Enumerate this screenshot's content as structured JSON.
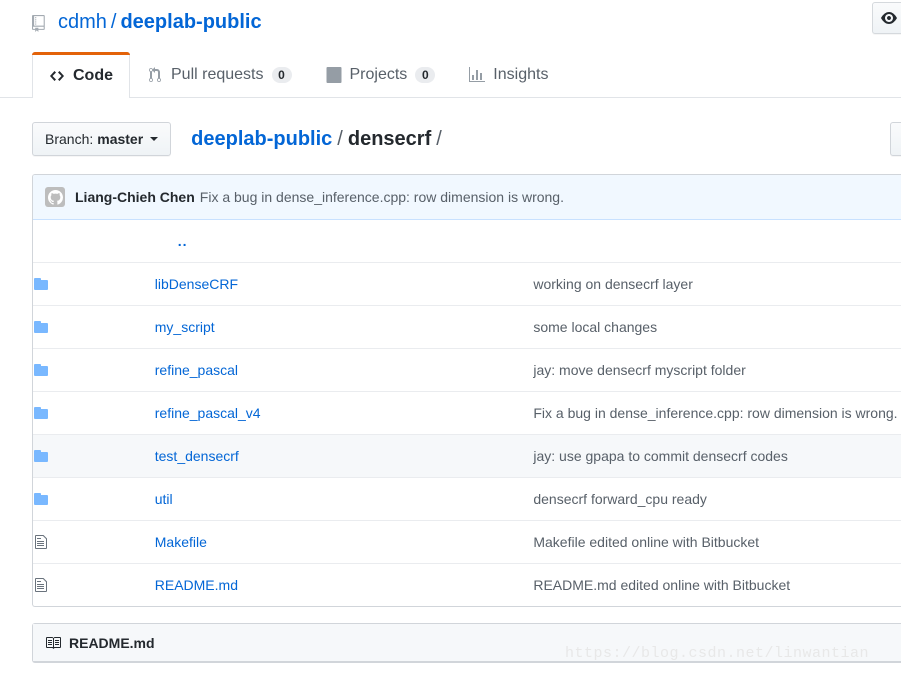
{
  "header": {
    "repo_icon": "repo-icon",
    "owner": "cdmh",
    "separator": "/",
    "name": "deeplab-public",
    "watch_icon": "eye-icon"
  },
  "tabs": [
    {
      "label": "Code",
      "icon": "code-icon",
      "count": null,
      "selected": true
    },
    {
      "label": "Pull requests",
      "icon": "git-pull-request-icon",
      "count": "0",
      "selected": false
    },
    {
      "label": "Projects",
      "icon": "project-board-icon",
      "count": "0",
      "selected": false
    },
    {
      "label": "Insights",
      "icon": "graph-icon",
      "count": null,
      "selected": false
    }
  ],
  "filebar": {
    "branch_prefix": "Branch:",
    "branch_name": "master",
    "caret_icon": "chevron-down-icon",
    "breadcrumb": {
      "root": "deeplab-public",
      "sep": "/",
      "current": "densecrf",
      "trailing_sep": "/"
    }
  },
  "commit": {
    "avatar_icon": "github-mark-avatar",
    "author": "Liang-Chieh Chen",
    "message": "Fix a bug in dense_inference.cpp: row dimension is wrong."
  },
  "updir": {
    "label": ".."
  },
  "files": [
    {
      "icon": "folder-icon",
      "type": "folder",
      "name": "libDenseCRF",
      "message": "working on densecrf layer",
      "hovered": false
    },
    {
      "icon": "folder-icon",
      "type": "folder",
      "name": "my_script",
      "message": "some local changes",
      "hovered": false
    },
    {
      "icon": "folder-icon",
      "type": "folder",
      "name": "refine_pascal",
      "message": "jay: move densecrf myscript folder",
      "hovered": false
    },
    {
      "icon": "folder-icon",
      "type": "folder",
      "name": "refine_pascal_v4",
      "message": "Fix a bug in dense_inference.cpp: row dimension is wrong.",
      "hovered": false
    },
    {
      "icon": "folder-icon",
      "type": "folder",
      "name": "test_densecrf",
      "message": "jay: use gpapa to commit densecrf codes",
      "hovered": true
    },
    {
      "icon": "folder-icon",
      "type": "folder",
      "name": "util",
      "message": "densecrf forward_cpu ready",
      "hovered": false
    },
    {
      "icon": "file-icon",
      "type": "file",
      "name": "Makefile",
      "message": "Makefile edited online with Bitbucket",
      "hovered": false
    },
    {
      "icon": "file-icon",
      "type": "file",
      "name": "README.md",
      "message": "README.md edited online with Bitbucket",
      "hovered": false
    }
  ],
  "readme": {
    "icon": "book-icon",
    "title": "README.md"
  },
  "watermark": {
    "text": "https://blog.csdn.net/linwantian"
  },
  "colors": {
    "link": "#0366d6",
    "accent_tab": "#e36209",
    "commit_bar_bg": "#f1f8ff",
    "commit_bar_border": "#c8e1ff",
    "folder_icon": "#79b8ff",
    "muted_text": "#586069",
    "border": "#d1d5da",
    "row_border": "#eaecef",
    "hover_bg": "#f6f8fa"
  }
}
